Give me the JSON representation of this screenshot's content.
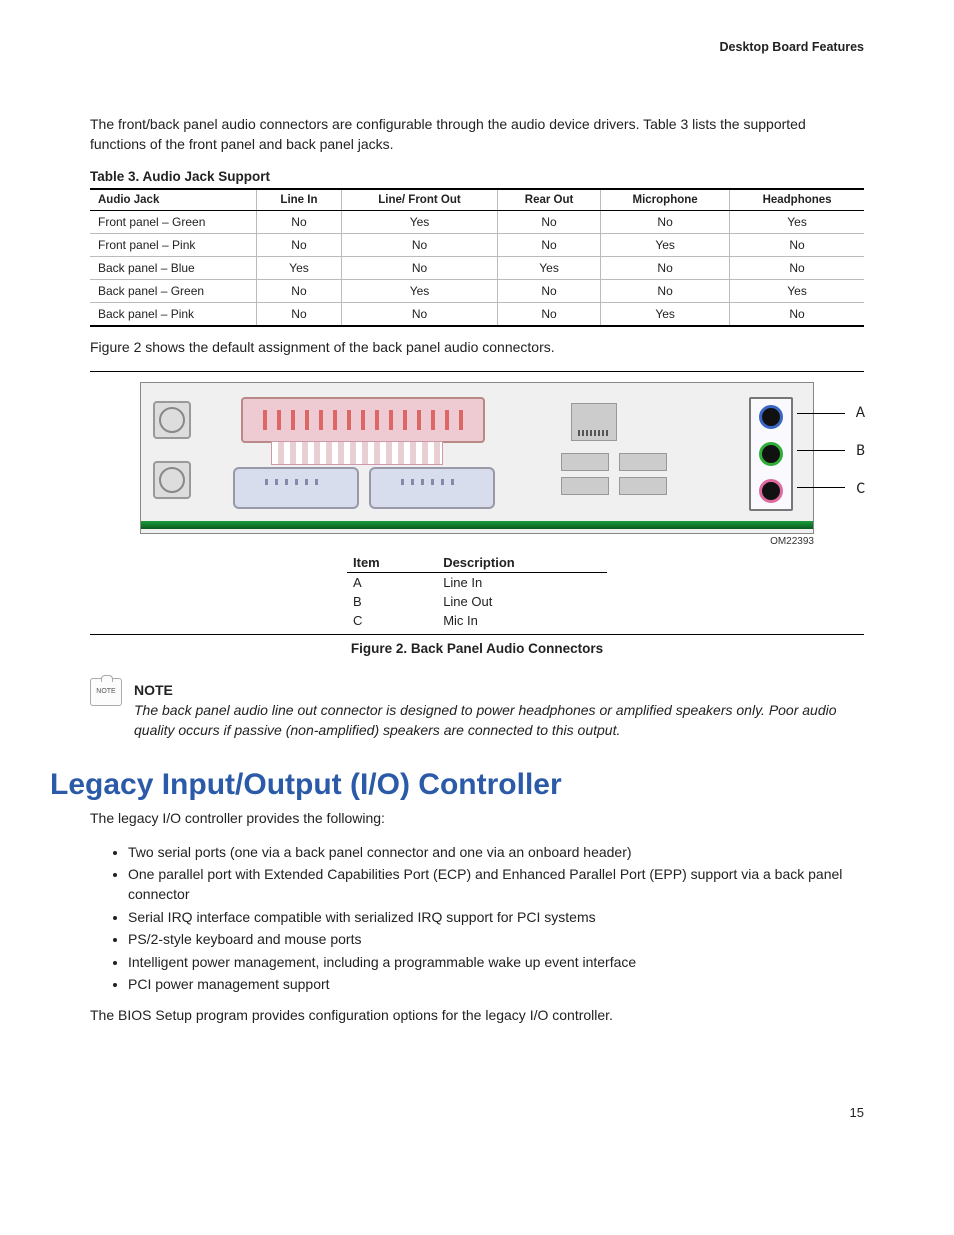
{
  "header": "Desktop Board Features",
  "intro": "The front/back panel audio connectors are configurable through the audio device drivers.  Table 3 lists the supported functions of the front panel and back panel jacks.",
  "table3": {
    "caption": "Table 3.  Audio Jack Support",
    "headers": [
      "Audio Jack",
      "Line In",
      "Line/ Front Out",
      "Rear Out",
      "Microphone",
      "Headphones"
    ],
    "rows": [
      [
        "Front panel – Green",
        "No",
        "Yes",
        "No",
        "No",
        "Yes"
      ],
      [
        "Front panel – Pink",
        "No",
        "No",
        "No",
        "Yes",
        "No"
      ],
      [
        "Back panel – Blue",
        "Yes",
        "No",
        "Yes",
        "No",
        "No"
      ],
      [
        "Back panel – Green",
        "No",
        "Yes",
        "No",
        "No",
        "Yes"
      ],
      [
        "Back panel – Pink",
        "No",
        "No",
        "No",
        "Yes",
        "No"
      ]
    ]
  },
  "fig2_intro": "Figure 2 shows the default assignment of the back panel audio connectors.",
  "figure2": {
    "om": "OM22393",
    "labels": {
      "A": "A",
      "B": "B",
      "C": "C"
    },
    "legend_headers": [
      "Item",
      "Description"
    ],
    "legend": [
      [
        "A",
        "Line In"
      ],
      [
        "B",
        "Line Out"
      ],
      [
        "C",
        "Mic In"
      ]
    ],
    "caption": "Figure 2.  Back Panel Audio Connectors"
  },
  "note": {
    "head": "NOTE",
    "body": "The back panel audio line out connector is designed to power headphones or amplified speakers only.  Poor audio quality occurs if passive (non-amplified) speakers are connected to this output."
  },
  "section": {
    "title": "Legacy Input/Output (I/O) Controller",
    "lead": "The legacy I/O controller provides the following:",
    "bullets": [
      "Two serial ports (one via a back panel connector and one via an onboard header)",
      "One parallel port with Extended Capabilities Port (ECP) and Enhanced Parallel Port (EPP) support via a back panel connector",
      "Serial IRQ interface compatible with serialized IRQ support for PCI systems",
      "PS/2-style keyboard and mouse ports",
      "Intelligent power management, including a programmable wake up event interface",
      "PCI power management support"
    ],
    "after": "The BIOS Setup program provides configuration options for the legacy I/O controller."
  },
  "pagenum": "15"
}
